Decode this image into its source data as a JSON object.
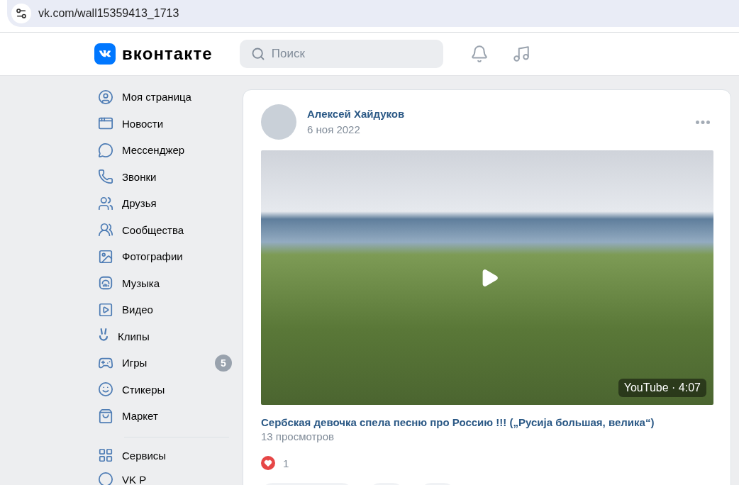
{
  "browser": {
    "address_bar": {
      "value": "vk.com/wall15359413_1713"
    }
  },
  "header": {
    "logo_text": "вконтакте",
    "search": {
      "placeholder": "Поиск"
    }
  },
  "sidebar": {
    "items": [
      {
        "label": "Моя страница"
      },
      {
        "label": "Новости"
      },
      {
        "label": "Мессенджер"
      },
      {
        "label": "Звонки"
      },
      {
        "label": "Друзья"
      },
      {
        "label": "Сообщества"
      },
      {
        "label": "Фотографии"
      },
      {
        "label": "Музыка"
      },
      {
        "label": "Видео"
      },
      {
        "label": "Клипы"
      },
      {
        "label": "Игры",
        "badge": "5"
      },
      {
        "label": "Стикеры"
      },
      {
        "label": "Маркет"
      }
    ],
    "more_items": [
      {
        "label": "Сервисы"
      },
      {
        "label": "VK P"
      }
    ]
  },
  "post": {
    "author": "Алексей Хайдуков",
    "date": "6 ноя 2022",
    "video": {
      "source_duration": "YouTube · 4:07"
    },
    "title": "Сербская девочка спела песню про Россию !!! („Русија большая, велика“)",
    "views": "13 просмотров",
    "reactions": {
      "count": "1"
    }
  }
}
